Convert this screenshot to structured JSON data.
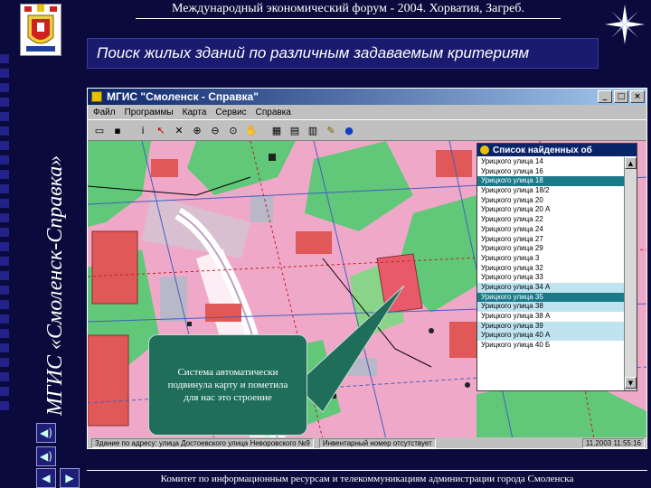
{
  "header": {
    "forum_title": "Международный экономический форум - 2004. Хорватия, Загреб.",
    "subtitle": "Поиск жилых зданий по различным задаваемым критериям",
    "vertical_title": "МГИС «Смоленск-Справка»"
  },
  "app": {
    "title": "МГИС \"Смоленск - Справка\"",
    "window_buttons": [
      "_",
      "□",
      "×"
    ],
    "menu": [
      "Файл",
      "Программы",
      "Карта",
      "Сервис",
      "Справка"
    ],
    "toolbar_icons": [
      "open-icon",
      "save-icon",
      "info-icon",
      "pointer-icon",
      "select-icon",
      "zoom-in-icon",
      "zoom-out-icon",
      "zoom-window-icon",
      "pan-icon",
      "layers-icon",
      "print-icon",
      "legend-icon",
      "search-icon",
      "globe-icon"
    ],
    "status": {
      "address": "Здание по адресу: улица Достоевского улица Неворовского №9",
      "object": "Инвентарный номер отсутствует",
      "date": "11.2003 11:55:16"
    }
  },
  "list_panel": {
    "title": "Список найденных об",
    "items": [
      "Урицкого улица 14",
      "Урицкого улица 16",
      "Урицкого улица 18",
      "Урицкого улица 18/2",
      "Урицкого улица 20",
      "Урицкого улица 20 А",
      "Урицкого улица 22",
      "Урицкого улица 24",
      "Урицкого улица 27",
      "Урицкого улица 29",
      "Урицкого улица 3",
      "Урицкого улица 32",
      "Урицкого улица 33",
      "Урицкого улица 34 А",
      "Урицкого улица 35",
      "Урицкого улица 38",
      "Урицкого улица 38 А",
      "Урицкого улица 39",
      "Урицкого улица 40 А",
      "Урицкого улица 40 Б"
    ],
    "selected_dark": [
      2,
      14
    ],
    "selected_light": [
      13,
      15,
      17,
      18
    ]
  },
  "callout": {
    "text": "Система автоматически подвинула карту и пометила для нас это строение"
  },
  "footer": {
    "text": "Комитет по информационным ресурсам и телекоммуникациям администрации города Смоленска"
  },
  "side_buttons": [
    "sound-icon",
    "sound-icon",
    "back-icon",
    "forward-icon"
  ],
  "colors": {
    "background": "#0a0a3c",
    "map_base": "#f0a8c8",
    "map_green": "#60c878",
    "building_red": "#e05858",
    "callout": "#1e6e5a",
    "selection": "#1a7a8a"
  }
}
